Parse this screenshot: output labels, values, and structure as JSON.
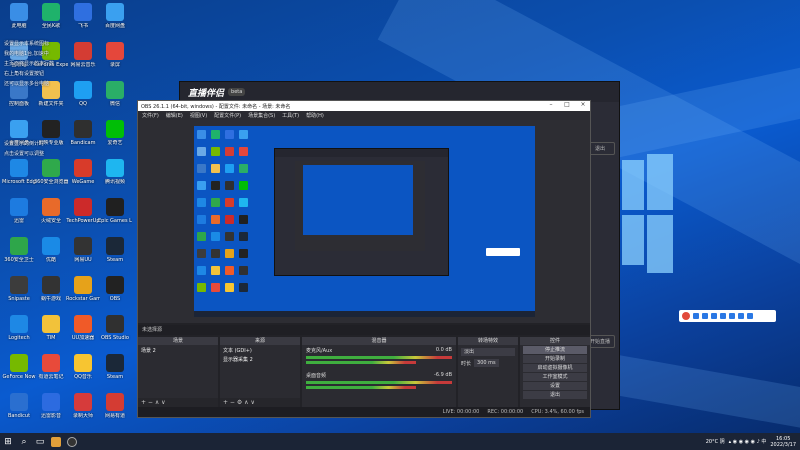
{
  "desktop": {
    "icons": [
      {
        "label": "此电脑",
        "color": "#3a8ee6"
      },
      {
        "label": "全民K歌",
        "color": "#1fb26b"
      },
      {
        "label": "飞书",
        "color": "#2f6fe0"
      },
      {
        "label": "百度网盘",
        "color": "#3aa0f0"
      },
      {
        "label": "回收站",
        "color": "#6aa9e6"
      },
      {
        "label": "GeForce Experience",
        "color": "#76b900"
      },
      {
        "label": "网易云音乐",
        "color": "#d43c33"
      },
      {
        "label": "录屏",
        "color": "#e5473b"
      },
      {
        "label": "控制面板",
        "color": "#3a78c8"
      },
      {
        "label": "新建文件夹",
        "color": "#f2c14e"
      },
      {
        "label": "QQ",
        "color": "#1e9ff2"
      },
      {
        "label": "微信",
        "color": "#2aae67"
      },
      {
        "label": "百度网盘",
        "color": "#3aa0f0"
      },
      {
        "label": "剪映专业版",
        "color": "#222222"
      },
      {
        "label": "Bandicam",
        "color": "#2f2f2f"
      },
      {
        "label": "爱奇艺",
        "color": "#00be06"
      },
      {
        "label": "Microsoft Edge",
        "color": "#1e88e5"
      },
      {
        "label": "360安全浏览器",
        "color": "#2fa94b"
      },
      {
        "label": "WeGame",
        "color": "#d83b2a"
      },
      {
        "label": "腾讯视频",
        "color": "#1eb6f0"
      },
      {
        "label": "迅雷",
        "color": "#1d7be0"
      },
      {
        "label": "火绒安全",
        "color": "#e86a2a"
      },
      {
        "label": "TechPowerUp",
        "color": "#cc2a2a"
      },
      {
        "label": "Epic Games Launcher",
        "color": "#202020"
      },
      {
        "label": "360安全卫士",
        "color": "#2ea64a"
      },
      {
        "label": "优酷",
        "color": "#1a8ae6"
      },
      {
        "label": "网易UU",
        "color": "#333333"
      },
      {
        "label": "Steam",
        "color": "#1b2838"
      },
      {
        "label": "Snipaste",
        "color": "#3c3c3c"
      },
      {
        "label": "蜗牛游戏",
        "color": "#333333"
      },
      {
        "label": "Rockstar Games Launcher",
        "color": "#e6a21a"
      },
      {
        "label": "OBS",
        "color": "#222222"
      },
      {
        "label": "Logitech",
        "color": "#1e88e5"
      },
      {
        "label": "TIM",
        "color": "#f2c23a"
      },
      {
        "label": "UU加速器",
        "color": "#f05a28"
      },
      {
        "label": "OBS Studio",
        "color": "#303030"
      },
      {
        "label": "GeForce Now",
        "color": "#76b900"
      },
      {
        "label": "有道云笔记",
        "color": "#e84a3a"
      },
      {
        "label": "QQ音乐",
        "color": "#f7c531"
      },
      {
        "label": "Steam",
        "color": "#1b2838"
      },
      {
        "label": "Bandicut",
        "color": "#2a6fd0"
      },
      {
        "label": "迅雷影音",
        "color": "#2c6be0"
      },
      {
        "label": "录制大师",
        "color": "#d63b3b"
      },
      {
        "label": "网易有道",
        "color": "#d43c33"
      }
    ],
    "text_lines": [
      "设置显示本系统图标",
      "我的电脑1台,加速中",
      "主页面将显示的本行数",
      "右上角有设置按钮",
      "还可以显示多台电脑",
      "设置显示的倒计时",
      "点击设置可以调整"
    ]
  },
  "live_app": {
    "title": "直播伴侣",
    "badge": "beta",
    "side_buttons": [
      "退出",
      "开始直播"
    ]
  },
  "obs": {
    "title": "OBS 26.1.1 (64-bit, windows) - 配置文件: 未命名 - 场景: 未命名",
    "menu": [
      "文件(F)",
      "编辑(E)",
      "视图(V)",
      "配置文件(P)",
      "场景集合(S)",
      "工具(T)",
      "帮助(H)"
    ],
    "scene_bar": "未选择源",
    "docks": {
      "scenes": {
        "title": "场景",
        "items": [
          "场景 2"
        ],
        "footer": "+ − ∧ ∨"
      },
      "sources": {
        "title": "来源",
        "items": [
          "文本 (GDI+)",
          "显示器采集 2"
        ],
        "footer": "+ − ⚙ ∧ ∨"
      },
      "mixer": {
        "title": "混音器",
        "channels": [
          {
            "name": "麦克风/Aux",
            "db": "0.0 dB"
          },
          {
            "name": "桌面音频",
            "db": "-6.9 dB"
          }
        ]
      },
      "transitions": {
        "title": "转场特效",
        "mode": "淡出",
        "duration_label": "时长",
        "duration": "300 ms"
      },
      "controls": {
        "title": "控件",
        "buttons": [
          "停止推流",
          "开始录制",
          "启动虚拟摄像机",
          "工作室模式",
          "设置",
          "退出"
        ]
      }
    },
    "status": [
      "LIVE: 00:00:00",
      "REC: 00:00:00",
      "CPU: 3.4%, 60.00 fps"
    ]
  },
  "taskbar": {
    "start_icon": "windows-icon",
    "weather": "20°C 阴",
    "time": "16:05",
    "date": "2022/3/17"
  },
  "colors": {
    "accent": "#0b55c2",
    "taskbar": "#1b2436"
  }
}
